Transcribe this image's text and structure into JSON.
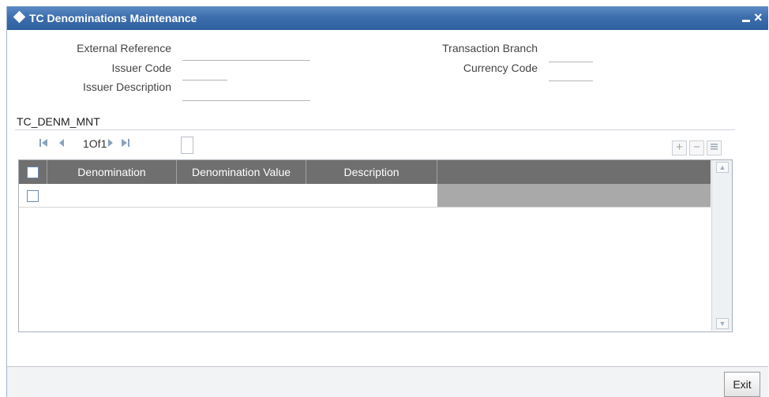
{
  "window": {
    "title": "TC Denominations Maintenance",
    "minimize_symbol": "",
    "close_symbol": "×"
  },
  "form": {
    "external_reference_label": "External Reference",
    "external_reference_value": "",
    "issuer_code_label": "Issuer Code",
    "issuer_code_value": "",
    "issuer_description_label": "Issuer Description",
    "issuer_description_value": "",
    "transaction_branch_label": "Transaction Branch",
    "transaction_branch_value": "",
    "currency_code_label": "Currency Code",
    "currency_code_value": ""
  },
  "section": {
    "title": "TC_DENM_MNT"
  },
  "pager": {
    "first_icon": "first-page-icon",
    "prev_icon": "prev-page-icon",
    "next_icon": "next-page-icon",
    "last_icon": "last-page-icon",
    "text": "1Of1"
  },
  "toolbar": {
    "add_icon": "plus-icon",
    "remove_icon": "minus-icon",
    "view_icon": "list-icon"
  },
  "grid": {
    "columns": [
      "Denomination",
      "Denomination Value",
      "Description"
    ],
    "rows": [
      {
        "denomination": "",
        "denomination_value": "",
        "description": ""
      }
    ]
  },
  "footer": {
    "exit_label": "Exit"
  },
  "colors": {
    "titlebar": "#3d6fae",
    "grid_header": "#6f6f6f"
  }
}
